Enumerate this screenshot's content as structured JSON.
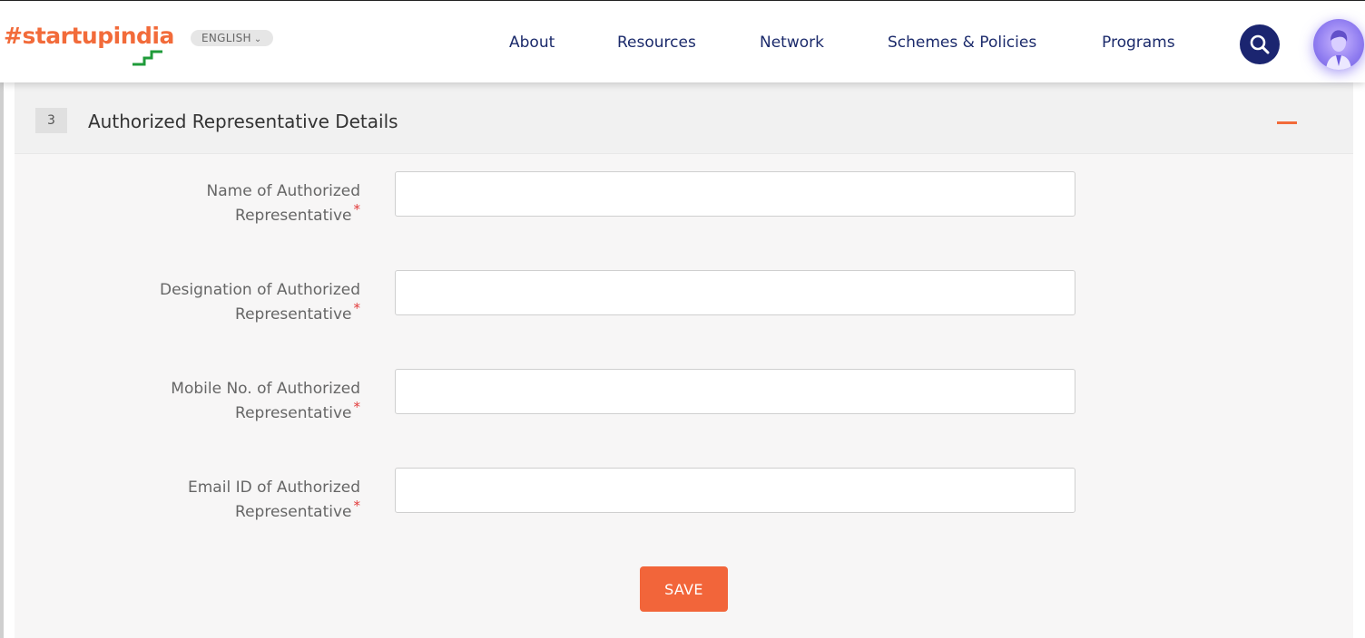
{
  "header": {
    "logo": {
      "hash": "#",
      "start": "startup",
      "india": "india"
    },
    "language": "ENGLISH",
    "nav": [
      {
        "label": "About"
      },
      {
        "label": "Resources"
      },
      {
        "label": "Network"
      },
      {
        "label": "Schemes & Policies"
      },
      {
        "label": "Programs"
      }
    ],
    "search_icon": "search-icon",
    "avatar_icon": "user-avatar-icon"
  },
  "section": {
    "step_number": "3",
    "title": "Authorized Representative Details",
    "collapse_icon": "minus-icon",
    "fields": [
      {
        "label_line1": "Name of Authorized",
        "label_line2": "Representative",
        "required": "*",
        "value": ""
      },
      {
        "label_line1": "Designation of Authorized",
        "label_line2": "Representative",
        "required": "*",
        "value": ""
      },
      {
        "label_line1": "Mobile No. of Authorized",
        "label_line2": "Representative",
        "required": "*",
        "value": ""
      },
      {
        "label_line1": "Email ID of Authorized",
        "label_line2": "Representative",
        "required": "*",
        "value": ""
      }
    ],
    "save_label": "SAVE"
  },
  "colors": {
    "brand_orange": "#f26b3a",
    "brand_navy": "#1b2570",
    "required_red": "#e23b3b"
  }
}
